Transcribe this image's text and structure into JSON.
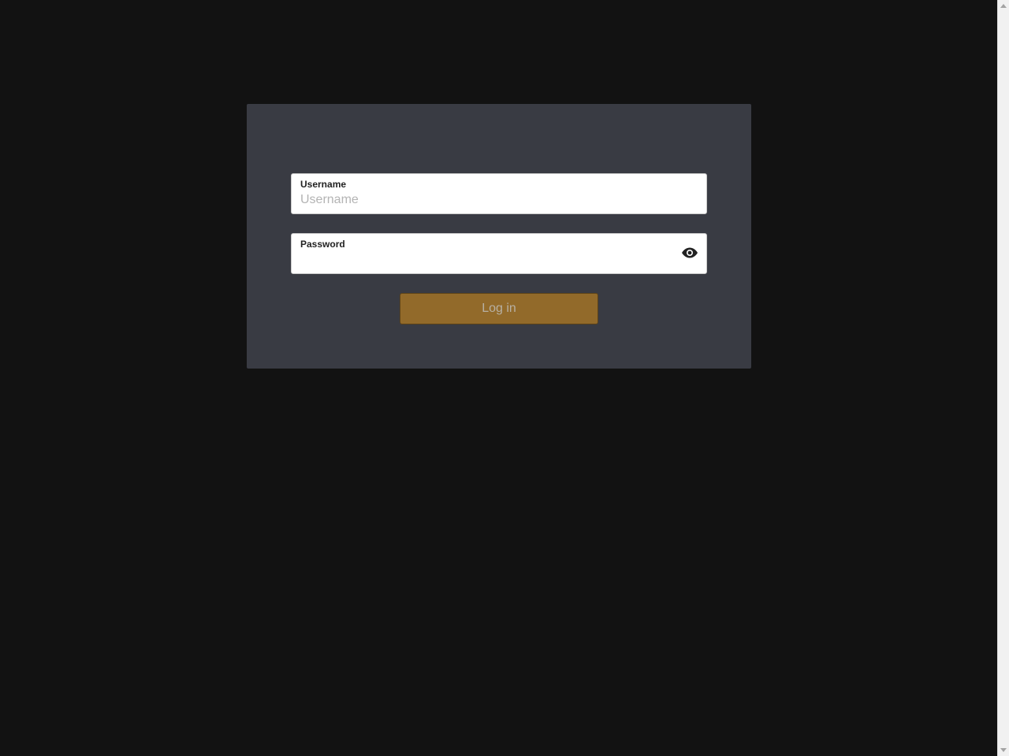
{
  "colors": {
    "page_background": "#121212",
    "card_background": "#393b43",
    "button_background": "#926a2a",
    "button_text": "#b7b0a3"
  },
  "login": {
    "username": {
      "label": "Username",
      "placeholder": "Username",
      "value": ""
    },
    "password": {
      "label": "Password",
      "placeholder": "",
      "value": "",
      "toggle_icon": "eye-icon"
    },
    "submit_label": "Log in"
  }
}
